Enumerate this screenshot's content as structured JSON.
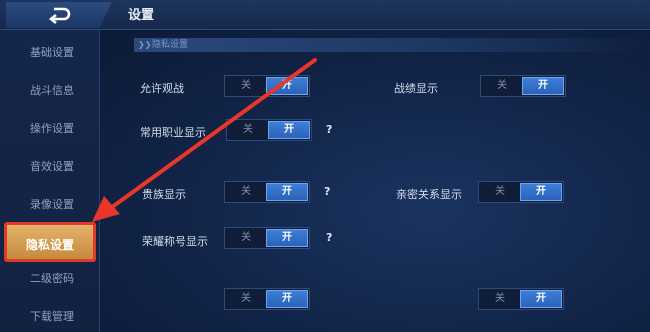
{
  "header": {
    "title": "设置"
  },
  "sidebar": {
    "items": [
      {
        "label": "基础设置",
        "active": false
      },
      {
        "label": "战斗信息",
        "active": false
      },
      {
        "label": "操作设置",
        "active": false
      },
      {
        "label": "音效设置",
        "active": false
      },
      {
        "label": "录像设置",
        "active": false
      },
      {
        "label": "隐私设置",
        "active": true
      },
      {
        "label": "二级密码",
        "active": false
      },
      {
        "label": "下载管理",
        "active": false
      }
    ]
  },
  "main": {
    "section_title": "隐私设置",
    "toggle_off_label": "关",
    "toggle_on_label": "开",
    "help_glyph": "?",
    "rows": [
      {
        "label": "允许观战",
        "value": "开"
      },
      {
        "label": "战绩显示",
        "value": "开"
      },
      {
        "label": "常用职业显示",
        "value": "开"
      },
      {
        "label": "贵族显示",
        "value": "开"
      },
      {
        "label": "亲密关系显示",
        "value": "开"
      },
      {
        "label": "荣耀称号显示",
        "value": "开"
      }
    ]
  },
  "colors": {
    "active_tab": "#d69f52",
    "toggle_on": "#3572c9",
    "annotation": "#e8372a"
  }
}
